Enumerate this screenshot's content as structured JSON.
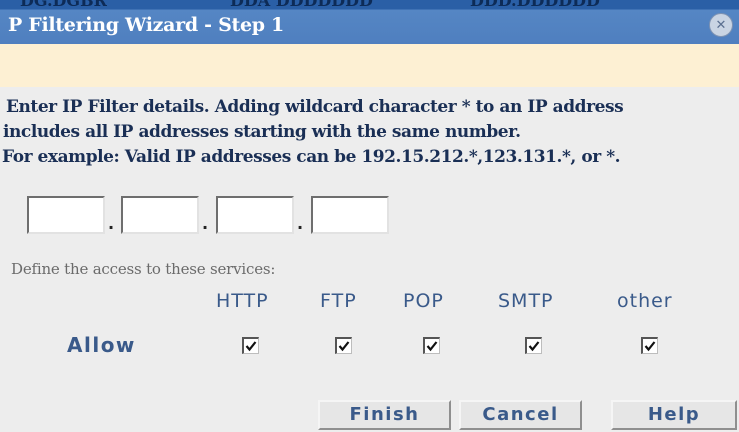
{
  "window": {
    "title": "P Filtering Wizard - Step 1",
    "ghost_text": [
      "DG.DGBR",
      "DDA DDDDDDD",
      "DDD.DDDDDD"
    ]
  },
  "instructions": {
    "line1": "Enter IP Filter details. Adding wildcard character * to an IP address",
    "line2": "includes all IP addresses starting with the same number.",
    "line3": "For example: Valid IP addresses can be 192.15.212.*,123.131.*, or *."
  },
  "ip_address": {
    "octets": [
      "",
      "",
      "",
      ""
    ],
    "separator": "."
  },
  "access": {
    "label": "Define the access to these services:",
    "row_label": "Allow",
    "services": [
      {
        "name": "HTTP",
        "checked": true
      },
      {
        "name": "FTP",
        "checked": true
      },
      {
        "name": "POP",
        "checked": true
      },
      {
        "name": "SMTP",
        "checked": true
      },
      {
        "name": "other",
        "checked": true
      }
    ]
  },
  "buttons": {
    "finish": "Finish",
    "cancel": "Cancel",
    "help": "Help"
  },
  "colors": {
    "title_bar": "#4f7fbf",
    "notice_band": "#fdf0d3",
    "label_blue": "#3a5a8a",
    "background": "#ededed"
  },
  "icons": {
    "close": "close-icon",
    "checkbox": "checkmark-icon"
  }
}
